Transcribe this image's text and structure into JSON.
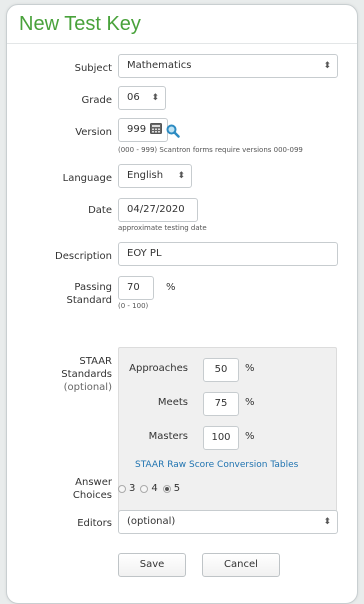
{
  "form": {
    "title": "New Test Key",
    "subject": {
      "label": "Subject",
      "value": "Mathematics"
    },
    "grade": {
      "label": "Grade",
      "value": "06"
    },
    "version": {
      "label": "Version",
      "value": "999",
      "hint": "(000 - 999) Scantron forms require versions 000-099"
    },
    "language": {
      "label": "Language",
      "value": "English"
    },
    "date": {
      "label": "Date",
      "value": "04/27/2020",
      "hint": "approximate testing date"
    },
    "description": {
      "label": "Description",
      "value": "EOY PL"
    },
    "passing_standard": {
      "label_line1": "Passing",
      "label_line2": "Standard",
      "value": "70",
      "unit": "%",
      "hint": "(0 - 100)"
    },
    "staar": {
      "label_line1": "STAAR",
      "label_line2": "Standards",
      "label_line3": "(optional)",
      "approaches": {
        "label": "Approaches",
        "value": "50",
        "unit": "%"
      },
      "meets": {
        "label": "Meets",
        "value": "75",
        "unit": "%"
      },
      "masters": {
        "label": "Masters",
        "value": "100",
        "unit": "%"
      },
      "link": "STAAR Raw Score Conversion Tables"
    },
    "answer_choices": {
      "label_line1": "Answer",
      "label_line2": "Choices",
      "options": [
        "3",
        "4",
        "5"
      ],
      "selected": "5"
    },
    "editors": {
      "label": "Editors",
      "value": "(optional)"
    },
    "buttons": {
      "save": "Save",
      "cancel": "Cancel"
    }
  },
  "colors": {
    "title": "#49a23b",
    "link": "#1f73b0"
  },
  "icons": {
    "calculator": "calculator-icon",
    "search": "search-icon",
    "select": "select-arrows-icon"
  }
}
